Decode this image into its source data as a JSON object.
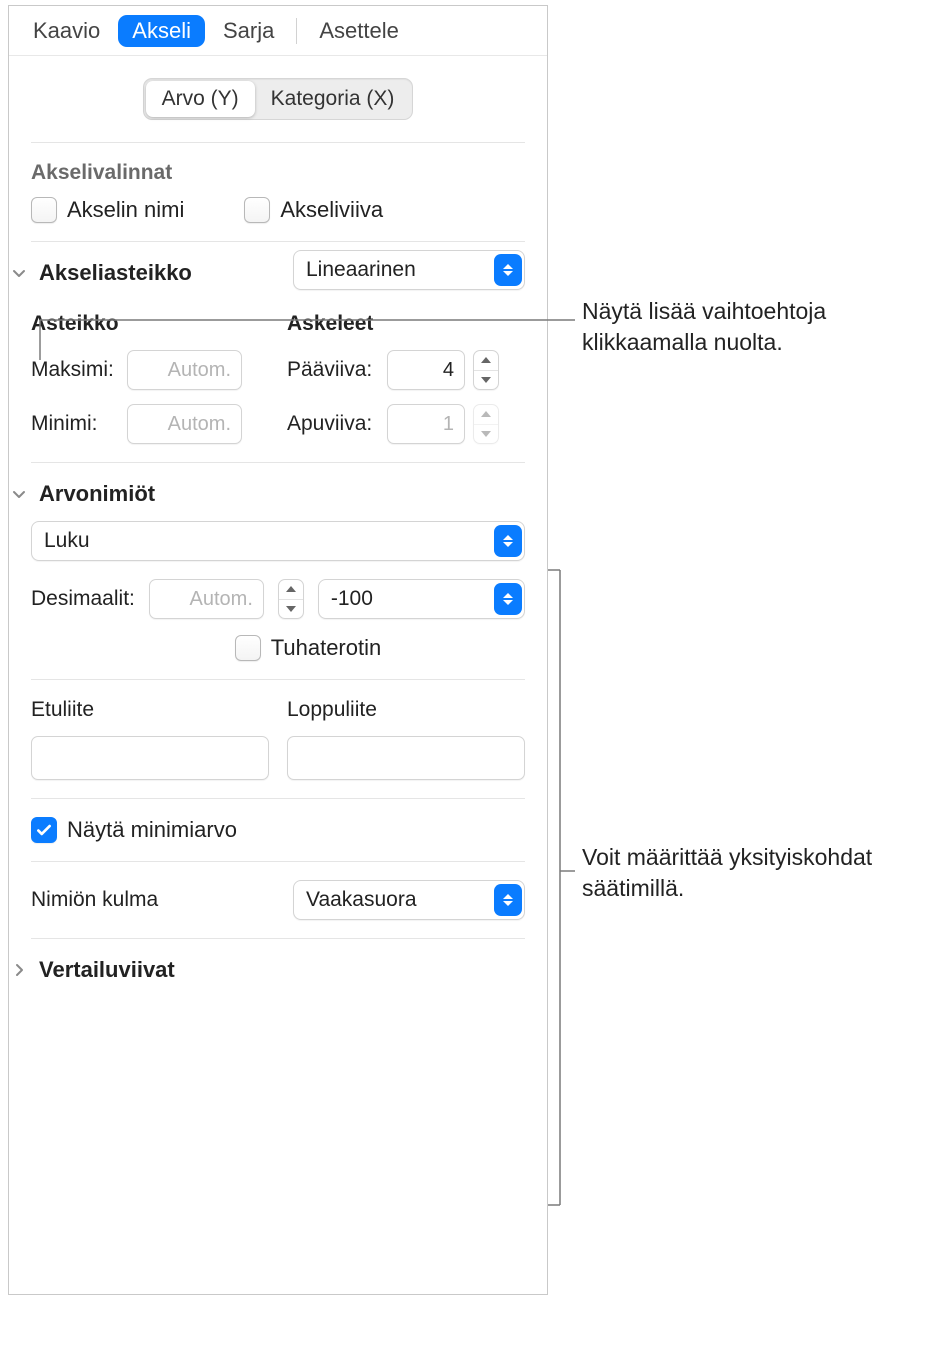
{
  "tabs": {
    "chart": "Kaavio",
    "axis": "Akseli",
    "series": "Sarja",
    "arrange": "Asettele"
  },
  "segmented": {
    "valueY": "Arvo (Y)",
    "categoryX": "Kategoria (X)"
  },
  "axisOptions": {
    "title": "Akselivalinnat",
    "axisName": "Akselin nimi",
    "axisLine": "Akseliviiva"
  },
  "axisScale": {
    "title": "Akseliasteikko",
    "scaleType": "Lineaarinen",
    "scaleHeading": "Asteikko",
    "stepsHeading": "Askeleet",
    "maxLabel": "Maksimi:",
    "maxPlaceholder": "Autom.",
    "minLabel": "Minimi:",
    "minPlaceholder": "Autom.",
    "majorLabel": "Pääviiva:",
    "majorValue": "4",
    "minorLabel": "Apuviiva:",
    "minorValue": "1"
  },
  "valueLabels": {
    "title": "Arvonimiöt",
    "formatType": "Luku",
    "decimalsLabel": "Desimaalit:",
    "decimalsPlaceholder": "Autom.",
    "negativeFormat": "-100",
    "thousandsSeparator": "Tuhaterotin"
  },
  "affixes": {
    "prefixLabel": "Etuliite",
    "suffixLabel": "Loppuliite",
    "prefixValue": "",
    "suffixValue": ""
  },
  "minValue": {
    "label": "Näytä minimiarvo"
  },
  "labelAngle": {
    "label": "Nimiön kulma",
    "value": "Vaakasuora"
  },
  "reference": {
    "title": "Vertailuviivat"
  },
  "callouts": {
    "c1": "Näytä lisää vaihtoehtoja klikkaamalla nuolta.",
    "c2": "Voit määrittää yksityiskohdat säätimillä."
  }
}
